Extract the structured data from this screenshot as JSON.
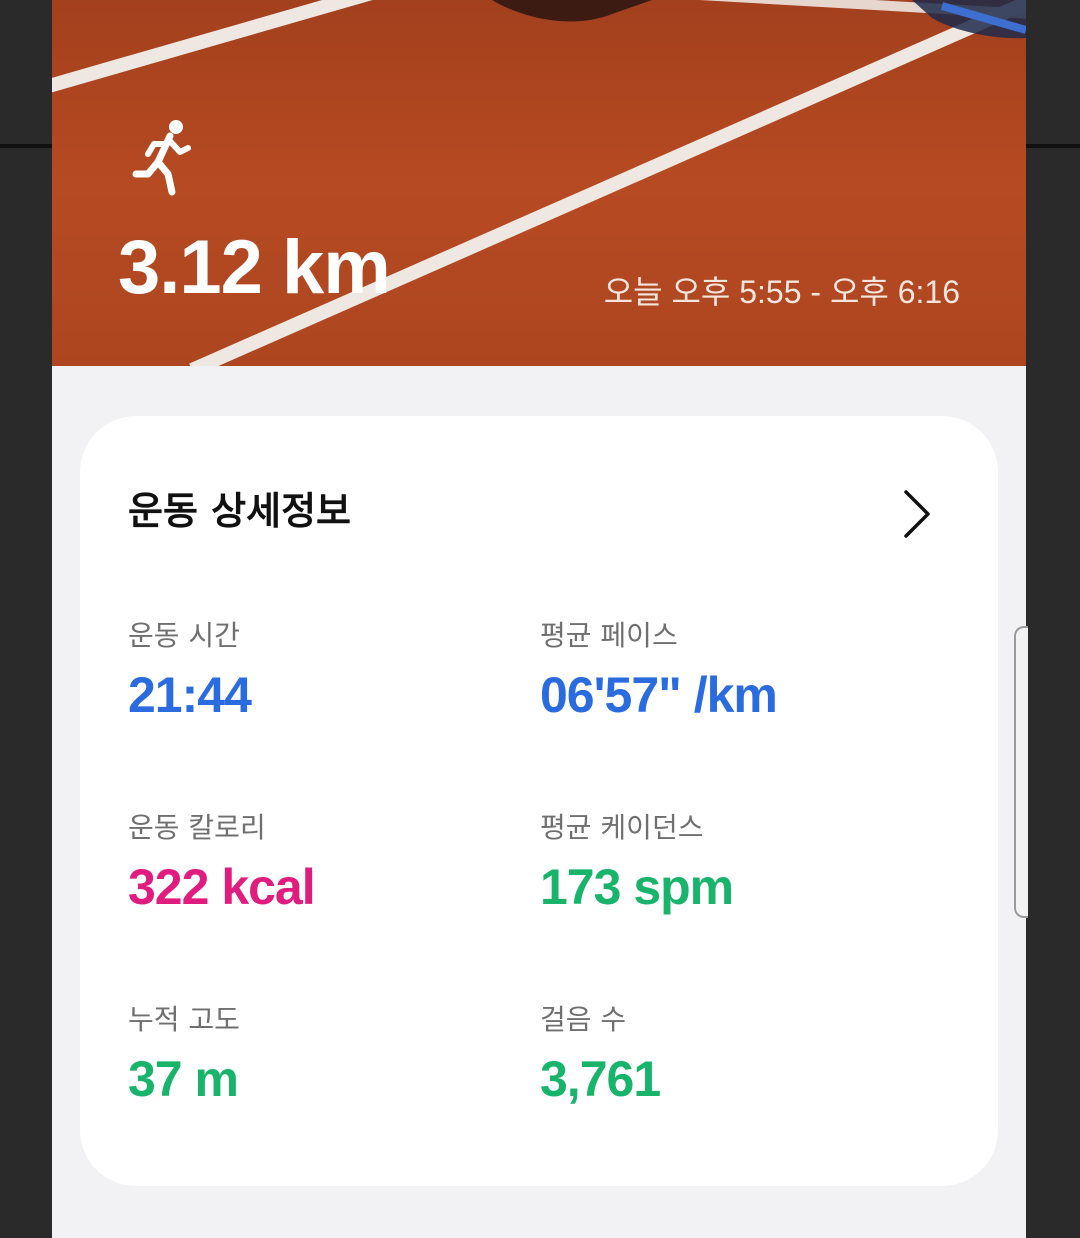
{
  "hero": {
    "distance": "3.12 km",
    "time_range": "오늘 오후 5:55 - 오후 6:16",
    "icon": "running-person-icon"
  },
  "details": {
    "title": "운동 상세정보",
    "more_icon": "chevron-right-icon",
    "stats": [
      {
        "label": "운동 시간",
        "value": "21:44",
        "color": "#2a6be0"
      },
      {
        "label": "평균 페이스",
        "value": "06'57\" /km",
        "color": "#2a6be0"
      },
      {
        "label": "운동 칼로리",
        "value": "322 kcal",
        "color": "#e11c7f"
      },
      {
        "label": "평균 케이던스",
        "value": "173 spm",
        "color": "#19b46b"
      },
      {
        "label": "누적 고도",
        "value": "37 m",
        "color": "#19b46b"
      },
      {
        "label": "걸음 수",
        "value": "3,761",
        "color": "#19b46b"
      }
    ]
  },
  "colors": {
    "track": "#b64a22",
    "card": "#ffffff",
    "background": "#f2f2f4"
  }
}
